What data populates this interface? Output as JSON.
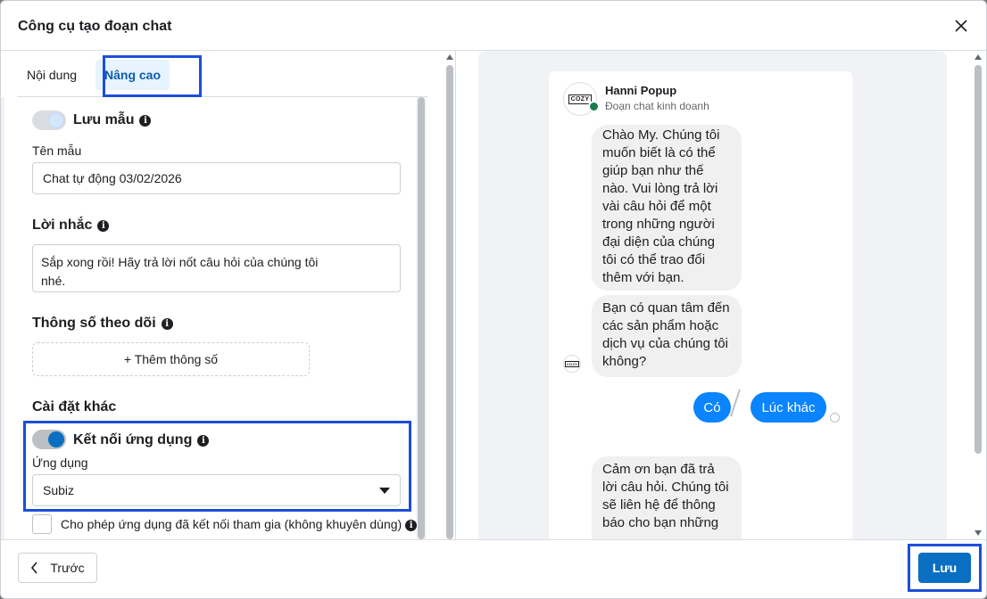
{
  "modal": {
    "title": "Công cụ tạo đoạn chat"
  },
  "tabs": [
    {
      "label": "Nội dung",
      "active": false
    },
    {
      "label": "Nâng cao",
      "active": true
    }
  ],
  "save_template": {
    "label": "Lưu mẫu",
    "enabled": false
  },
  "template_name": {
    "label": "Tên mẫu",
    "value": "Chat tự động 03/02/2026"
  },
  "reminder": {
    "label": "Lời nhắc",
    "value": "Sắp xong rồi! Hãy trả lời nốt câu hỏi của chúng tôi nhé."
  },
  "tracking": {
    "label": "Thông số theo dõi",
    "add_button": "+ Thêm thông số"
  },
  "other_settings": {
    "label": "Cài đặt khác",
    "connect_app": {
      "label": "Kết nối ứng dụng",
      "enabled": true
    },
    "app": {
      "label": "Ứng dụng",
      "selected": "Subiz"
    },
    "allow_connected": {
      "label": "Cho phép ứng dụng đã kết nối tham gia (không khuyên dùng)",
      "checked": false
    }
  },
  "preview": {
    "page_name": "Hanni Popup",
    "page_subtitle": "Đoạn chat kinh doanh",
    "avatar_text": "COZY",
    "messages": [
      "Chào My. Chúng tôi muốn biết là có thể giúp bạn như thế nào. Vui lòng trả lời vài câu hỏi để một trong những người đại diện của chúng tôi có thể trao đổi thêm với bạn.",
      "Bạn có quan tâm đến các sản phẩm hoặc dịch vụ của chúng tôi không?",
      "Cảm ơn bạn đã trả lời câu hỏi. Chúng tôi sẽ liên hệ để thông báo cho bạn những"
    ],
    "quick_replies": [
      "Có",
      "Lúc khác"
    ]
  },
  "footer": {
    "back_label": "Trước",
    "save_label": "Lưu"
  },
  "colors": {
    "primary": "#0a6fc2",
    "messenger_blue": "#0a84ff",
    "highlight": "#1d4ed8",
    "tab_active_bg": "#e7f3ff"
  }
}
